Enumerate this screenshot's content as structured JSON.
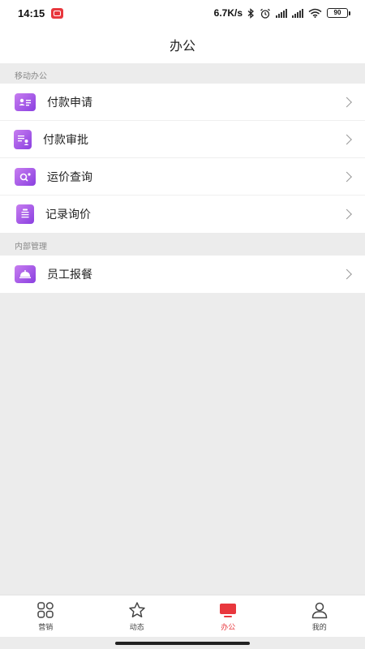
{
  "status_bar": {
    "time": "14:15",
    "net_speed": "6.7K/s",
    "battery": "90",
    "icons": [
      "notification-app-icon",
      "bluetooth-icon",
      "alarm-icon",
      "signal-icon",
      "signal-icon",
      "wifi-icon",
      "battery-icon"
    ]
  },
  "header": {
    "title": "办公"
  },
  "sections": [
    {
      "label": "移动办公",
      "items": [
        {
          "label": "付款申请",
          "icon": "id-card-icon"
        },
        {
          "label": "付款审批",
          "icon": "document-user-icon"
        },
        {
          "label": "运价查询",
          "icon": "search-image-icon"
        },
        {
          "label": "记录询价",
          "icon": "clipboard-icon"
        }
      ]
    },
    {
      "label": "内部管理",
      "items": [
        {
          "label": "员工报餐",
          "icon": "meal-cloche-icon"
        }
      ]
    }
  ],
  "bottom_nav": {
    "items": [
      {
        "label": "营销",
        "icon": "grid-icon",
        "active": false
      },
      {
        "label": "动态",
        "icon": "star-icon",
        "active": false
      },
      {
        "label": "办公",
        "icon": "monitor-icon",
        "active": true
      },
      {
        "label": "我的",
        "icon": "user-icon",
        "active": false
      }
    ],
    "active_color": "#e8373d"
  },
  "colors": {
    "accent": "#e8373d",
    "icon_gradient_start": "#c77df0",
    "icon_gradient_end": "#8a3fe0",
    "background": "#ececec"
  }
}
